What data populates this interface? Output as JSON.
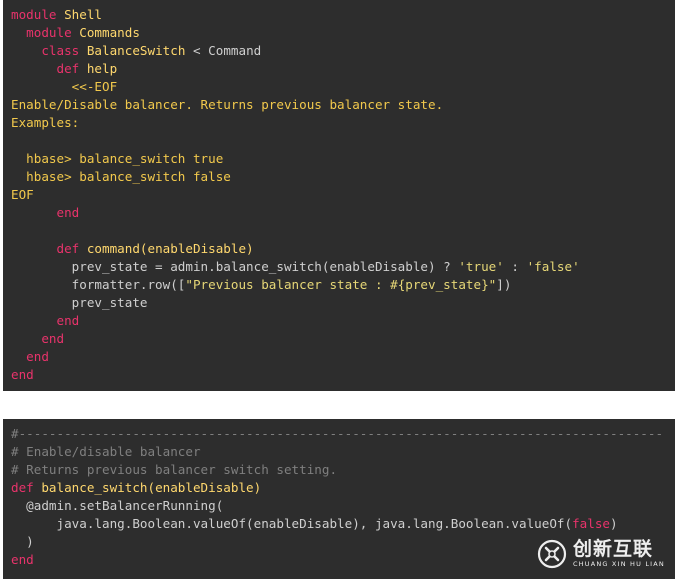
{
  "panels": [
    {
      "lines": [
        [
          {
            "t": "module",
            "c": "kw"
          },
          {
            "t": " Shell",
            "c": "name"
          }
        ],
        [
          {
            "t": "  module",
            "c": "kw"
          },
          {
            "t": " Commands",
            "c": "name"
          }
        ],
        [
          {
            "t": "    class",
            "c": "kw"
          },
          {
            "t": " BalanceSwitch",
            "c": "name"
          },
          {
            "t": " < Command",
            "c": "plain"
          }
        ],
        [
          {
            "t": "      def",
            "c": "kw"
          },
          {
            "t": " help",
            "c": "name"
          }
        ],
        [
          {
            "t": "        <<-EOF",
            "c": "heredoc"
          }
        ],
        [
          {
            "t": "Enable/Disable balancer. Returns previous balancer state.",
            "c": "heredoc"
          }
        ],
        [
          {
            "t": "Examples:",
            "c": "heredoc"
          }
        ],
        [
          {
            "t": "",
            "c": "blank"
          }
        ],
        [
          {
            "t": "  hbase> balance_switch true",
            "c": "heredoc"
          }
        ],
        [
          {
            "t": "  hbase> balance_switch false",
            "c": "heredoc"
          }
        ],
        [
          {
            "t": "EOF",
            "c": "heredoc"
          }
        ],
        [
          {
            "t": "      end",
            "c": "kw"
          }
        ],
        [
          {
            "t": "",
            "c": "blank"
          }
        ],
        [
          {
            "t": "      def",
            "c": "kw"
          },
          {
            "t": " command(enableDisable)",
            "c": "name"
          }
        ],
        [
          {
            "t": "        prev_state = admin.balance_switch(enableDisable) ? ",
            "c": "plain"
          },
          {
            "t": "'true'",
            "c": "str"
          },
          {
            "t": " : ",
            "c": "plain"
          },
          {
            "t": "'false'",
            "c": "str"
          }
        ],
        [
          {
            "t": "        formatter.row([",
            "c": "plain"
          },
          {
            "t": "\"Previous balancer state : #{prev_state}\"",
            "c": "str"
          },
          {
            "t": "])",
            "c": "plain"
          }
        ],
        [
          {
            "t": "        prev_state",
            "c": "plain"
          }
        ],
        [
          {
            "t": "      end",
            "c": "kw"
          }
        ],
        [
          {
            "t": "    end",
            "c": "kw"
          }
        ],
        [
          {
            "t": "  end",
            "c": "kw"
          }
        ],
        [
          {
            "t": "end",
            "c": "kw"
          }
        ]
      ]
    },
    {
      "lines": [
        [
          {
            "t": "#-------------------------------------------------------------------------------------",
            "c": "comment"
          }
        ],
        [
          {
            "t": "# Enable/disable balancer",
            "c": "comment"
          }
        ],
        [
          {
            "t": "# Returns previous balancer switch setting.",
            "c": "comment"
          }
        ],
        [
          {
            "t": "def",
            "c": "kw"
          },
          {
            "t": " balance_switch(enableDisable)",
            "c": "name"
          }
        ],
        [
          {
            "t": "  @admin.setBalancerRunning(",
            "c": "plain"
          }
        ],
        [
          {
            "t": "      java.lang.Boolean.valueOf(enableDisable), java.lang.Boolean.valueOf(",
            "c": "plain"
          },
          {
            "t": "false",
            "c": "kw2"
          },
          {
            "t": ")",
            "c": "plain"
          }
        ],
        [
          {
            "t": "  )",
            "c": "plain"
          }
        ],
        [
          {
            "t": "end",
            "c": "kw"
          }
        ]
      ]
    }
  ],
  "watermark": {
    "brand_cn": "创新互联",
    "brand_en": "CHUANG XIN HU LIAN"
  }
}
